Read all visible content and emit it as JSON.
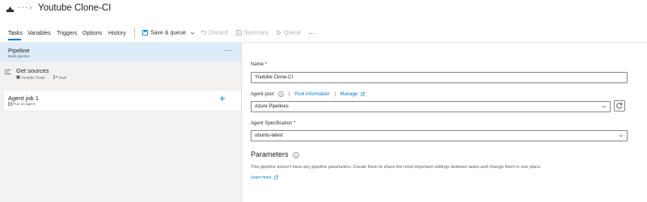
{
  "header": {
    "breadcrumb_more": "···",
    "separator": "›",
    "title": "Youtube Clone-CI"
  },
  "toolbar": {
    "tabs": [
      {
        "label": "Tasks",
        "active": true
      },
      {
        "label": "Variables"
      },
      {
        "label": "Triggers"
      },
      {
        "label": "Options"
      },
      {
        "label": "History"
      }
    ],
    "save_queue_label": "Save & queue",
    "discard_label": "Discard",
    "summary_label": "Summary",
    "queue_label": "Queue",
    "more_label": "···"
  },
  "pipeline": {
    "title": "Pipeline",
    "subtitle": "Build pipeline",
    "more": "···"
  },
  "get_sources": {
    "title": "Get sources",
    "repo": "Youtube Clone",
    "branch": "main"
  },
  "agent_job": {
    "title": "Agent job 1",
    "subtitle": "Run on agent",
    "add": "+"
  },
  "form": {
    "name_label": "Name *",
    "name_value": "Youtube Clone-CI",
    "agent_pool_label": "Agent pool",
    "pool_info_link": "Pool information",
    "separator": "|",
    "manage_link": "Manage",
    "agent_pool_value": "Azure Pipelines",
    "agent_spec_label": "Agent Specification *",
    "agent_spec_value": "ubuntu-latest"
  },
  "parameters": {
    "title": "Parameters",
    "description": "This pipeline doesn't have any pipeline parameters. Create them to share the most important settings between tasks and change them in one place.",
    "learn_more": "Learn more"
  },
  "colors": {
    "accent": "#0078d4",
    "selected_row": "#deecf9",
    "left_panel": "#f3f2f1"
  }
}
